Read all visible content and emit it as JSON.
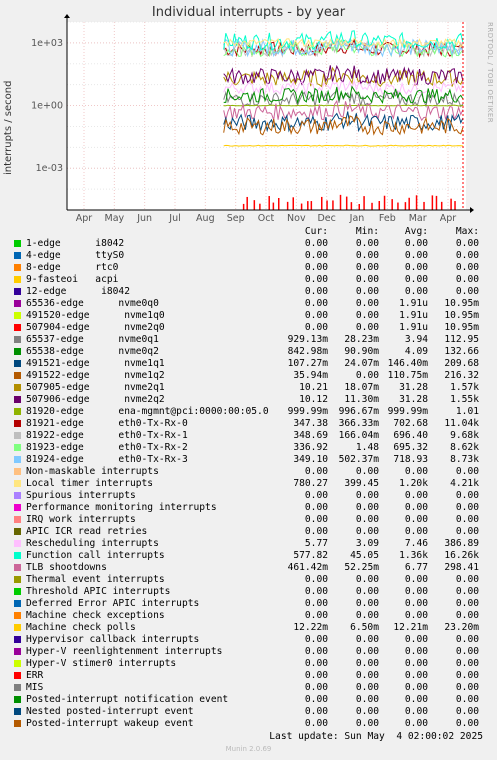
{
  "title": "Individual interrupts - by year",
  "ylabel": "interrupts / second",
  "side_label": "RRDTOOL / TOBI OETIKER",
  "legend_headers": {
    "cur": "Cur:",
    "min": "Min:",
    "avg": "Avg:",
    "max": "Max:"
  },
  "legend": [
    {
      "name": "1-edge      i8042",
      "color": "#00cc00",
      "cur": "0.00",
      "min": "0.00",
      "avg": "0.00",
      "max": "0.00"
    },
    {
      "name": "4-edge      ttyS0",
      "color": "#0066b3",
      "cur": "0.00",
      "min": "0.00",
      "avg": "0.00",
      "max": "0.00"
    },
    {
      "name": "8-edge      rtc0",
      "color": "#ff8000",
      "cur": "0.00",
      "min": "0.00",
      "avg": "0.00",
      "max": "0.00"
    },
    {
      "name": "9-fasteoi   acpi",
      "color": "#ffcc00",
      "cur": "0.00",
      "min": "0.00",
      "avg": "0.00",
      "max": "0.00"
    },
    {
      "name": "12-edge      i8042",
      "color": "#330099",
      "cur": "0.00",
      "min": "0.00",
      "avg": "0.00",
      "max": "0.00"
    },
    {
      "name": "65536-edge      nvme0q0",
      "color": "#990099",
      "cur": "0.00",
      "min": "0.00",
      "avg": "1.91u",
      "max": "10.95m"
    },
    {
      "name": "491520-edge      nvme1q0",
      "color": "#ccff00",
      "cur": "0.00",
      "min": "0.00",
      "avg": "1.91u",
      "max": "10.95m"
    },
    {
      "name": "507904-edge      nvme2q0",
      "color": "#ff0000",
      "cur": "0.00",
      "min": "0.00",
      "avg": "1.91u",
      "max": "10.95m"
    },
    {
      "name": "65537-edge      nvme0q1",
      "color": "#808080",
      "cur": "929.13m",
      "min": "28.23m",
      "avg": "3.94",
      "max": "112.95"
    },
    {
      "name": "65538-edge      nvme0q2",
      "color": "#008f00",
      "cur": "842.98m",
      "min": "90.90m",
      "avg": "4.09",
      "max": "132.66"
    },
    {
      "name": "491521-edge      nvme1q1",
      "color": "#00487d",
      "cur": "107.27m",
      "min": "24.07m",
      "avg": "146.40m",
      "max": "209.68"
    },
    {
      "name": "491522-edge      nvme1q2",
      "color": "#b35a00",
      "cur": "35.94m",
      "min": "0.00",
      "avg": "110.75m",
      "max": "216.32"
    },
    {
      "name": "507905-edge      nvme2q1",
      "color": "#b38f00",
      "cur": "10.21",
      "min": "18.07m",
      "avg": "31.28",
      "max": "1.57k"
    },
    {
      "name": "507906-edge      nvme2q2",
      "color": "#6b006b",
      "cur": "10.12",
      "min": "11.30m",
      "avg": "31.28",
      "max": "1.55k"
    },
    {
      "name": "81920-edge      ena-mgmnt@pci:0000:00:05.0",
      "color": "#8fb300",
      "cur": "999.99m",
      "min": "996.67m",
      "avg": "999.99m",
      "max": "1.01"
    },
    {
      "name": "81921-edge      eth0-Tx-Rx-0",
      "color": "#b30000",
      "cur": "347.38",
      "min": "366.33m",
      "avg": "702.68",
      "max": "11.04k"
    },
    {
      "name": "81922-edge      eth0-Tx-Rx-1",
      "color": "#bebebe",
      "cur": "348.69",
      "min": "166.04m",
      "avg": "696.40",
      "max": "9.68k"
    },
    {
      "name": "81923-edge      eth0-Tx-Rx-2",
      "color": "#80ff80",
      "cur": "336.92",
      "min": "1.48",
      "avg": "695.32",
      "max": "8.62k"
    },
    {
      "name": "81924-edge      eth0-Tx-Rx-3",
      "color": "#80c9ff",
      "cur": "349.10",
      "min": "502.37m",
      "avg": "718.93",
      "max": "8.73k"
    },
    {
      "name": "Non-maskable interrupts",
      "color": "#ffc080",
      "cur": "0.00",
      "min": "0.00",
      "avg": "0.00",
      "max": "0.00"
    },
    {
      "name": "Local timer interrupts",
      "color": "#ffe680",
      "cur": "780.27",
      "min": "399.45",
      "avg": "1.20k",
      "max": "4.21k"
    },
    {
      "name": "Spurious interrupts",
      "color": "#aa80ff",
      "cur": "0.00",
      "min": "0.00",
      "avg": "0.00",
      "max": "0.00"
    },
    {
      "name": "Performance monitoring interrupts",
      "color": "#ee00cc",
      "cur": "0.00",
      "min": "0.00",
      "avg": "0.00",
      "max": "0.00"
    },
    {
      "name": "IRQ work interrupts",
      "color": "#ff8080",
      "cur": "0.00",
      "min": "0.00",
      "avg": "0.00",
      "max": "0.00"
    },
    {
      "name": "APIC ICR read retries",
      "color": "#666600",
      "cur": "0.00",
      "min": "0.00",
      "avg": "0.00",
      "max": "0.00"
    },
    {
      "name": "Rescheduling interrupts",
      "color": "#ffbfff",
      "cur": "5.77",
      "min": "3.09",
      "avg": "7.46",
      "max": "386.89"
    },
    {
      "name": "Function call interrupts",
      "color": "#00ffcc",
      "cur": "577.82",
      "min": "45.05",
      "avg": "1.36k",
      "max": "16.26k"
    },
    {
      "name": "TLB shootdowns",
      "color": "#cc6699",
      "cur": "461.42m",
      "min": "52.25m",
      "avg": "6.77",
      "max": "298.41"
    },
    {
      "name": "Thermal event interrupts",
      "color": "#999900",
      "cur": "0.00",
      "min": "0.00",
      "avg": "0.00",
      "max": "0.00"
    },
    {
      "name": "Threshold APIC interrupts",
      "color": "#00cc00",
      "cur": "0.00",
      "min": "0.00",
      "avg": "0.00",
      "max": "0.00"
    },
    {
      "name": "Deferred Error APIC interrupts",
      "color": "#0066b3",
      "cur": "0.00",
      "min": "0.00",
      "avg": "0.00",
      "max": "0.00"
    },
    {
      "name": "Machine check exceptions",
      "color": "#ff8000",
      "cur": "0.00",
      "min": "0.00",
      "avg": "0.00",
      "max": "0.00"
    },
    {
      "name": "Machine check polls",
      "color": "#ffcc00",
      "cur": "12.22m",
      "min": "6.50m",
      "avg": "12.21m",
      "max": "23.20m"
    },
    {
      "name": "Hypervisor callback interrupts",
      "color": "#330099",
      "cur": "0.00",
      "min": "0.00",
      "avg": "0.00",
      "max": "0.00"
    },
    {
      "name": "Hyper-V reenlightenment interrupts",
      "color": "#990099",
      "cur": "0.00",
      "min": "0.00",
      "avg": "0.00",
      "max": "0.00"
    },
    {
      "name": "Hyper-V stimer0 interrupts",
      "color": "#ccff00",
      "cur": "0.00",
      "min": "0.00",
      "avg": "0.00",
      "max": "0.00"
    },
    {
      "name": "ERR",
      "color": "#ff0000",
      "cur": "0.00",
      "min": "0.00",
      "avg": "0.00",
      "max": "0.00"
    },
    {
      "name": "MIS",
      "color": "#808080",
      "cur": "0.00",
      "min": "0.00",
      "avg": "0.00",
      "max": "0.00"
    },
    {
      "name": "Posted-interrupt notification event",
      "color": "#008f00",
      "cur": "0.00",
      "min": "0.00",
      "avg": "0.00",
      "max": "0.00"
    },
    {
      "name": "Nested posted-interrupt event",
      "color": "#00487d",
      "cur": "0.00",
      "min": "0.00",
      "avg": "0.00",
      "max": "0.00"
    },
    {
      "name": "Posted-interrupt wakeup event",
      "color": "#b35a00",
      "cur": "0.00",
      "min": "0.00",
      "avg": "0.00",
      "max": "0.00"
    }
  ],
  "footer": "Last update: Sun May  4 02:00:02 2025",
  "version": "Munin 2.0.69",
  "chart_data": {
    "type": "line",
    "title": "Individual interrupts - by year",
    "ylabel": "interrupts / second",
    "yscale": "log",
    "ylim": [
      1e-05,
      10000.0
    ],
    "yticks": [
      {
        "value": 1000,
        "label": "1e+03"
      },
      {
        "value": 1,
        "label": "1e+00"
      },
      {
        "value": 0.001,
        "label": "1e-03"
      }
    ],
    "xticks": [
      "Apr",
      "May",
      "Jun",
      "Jul",
      "Aug",
      "Sep",
      "Oct",
      "Nov",
      "Dec",
      "Jan",
      "Feb",
      "Mar",
      "Apr"
    ],
    "data_start_month": "Sep",
    "grid": true,
    "series": [
      {
        "name": "81921-edge      eth0-Tx-Rx-0",
        "color": "#b30000",
        "level": 500,
        "amp": 0.35
      },
      {
        "name": "81922-edge      eth0-Tx-Rx-1",
        "color": "#bebebe",
        "level": 520,
        "amp": 0.35
      },
      {
        "name": "81923-edge      eth0-Tx-Rx-2",
        "color": "#80ff80",
        "level": 480,
        "amp": 0.35
      },
      {
        "name": "81924-edge      eth0-Tx-Rx-3",
        "color": "#80c9ff",
        "level": 600,
        "amp": 0.4
      },
      {
        "name": "Function call interrupts",
        "color": "#00ffcc",
        "level": 1200,
        "amp": 0.4
      },
      {
        "name": "Local timer interrupts",
        "color": "#ffe680",
        "level": 1000,
        "amp": 0.2
      },
      {
        "name": "507905-edge      nvme2q1",
        "color": "#b38f00",
        "level": 20,
        "amp": 0.4
      },
      {
        "name": "507906-edge      nvme2q2",
        "color": "#6b006b",
        "level": 25,
        "amp": 0.4
      },
      {
        "name": "Rescheduling interrupts",
        "color": "#ffbfff",
        "level": 7,
        "amp": 0.3
      },
      {
        "name": "65537-edge      nvme0q1",
        "color": "#808080",
        "level": 2,
        "amp": 0.35
      },
      {
        "name": "65538-edge      nvme0q2",
        "color": "#008f00",
        "level": 3,
        "amp": 0.35
      },
      {
        "name": "81920-edge      ena-mgmnt@pci:0000:00:05.0",
        "color": "#8fb300",
        "level": 1,
        "amp": 0.02
      },
      {
        "name": "TLB shootdowns",
        "color": "#cc6699",
        "level": 0.5,
        "amp": 0.4
      },
      {
        "name": "491521-edge      nvme1q1",
        "color": "#00487d",
        "level": 0.15,
        "amp": 0.4
      },
      {
        "name": "491522-edge      nvme1q2",
        "color": "#b35a00",
        "level": 0.1,
        "amp": 0.4
      },
      {
        "name": "Machine check polls",
        "color": "#ffcc00",
        "level": 0.012,
        "amp": 0.02
      }
    ]
  }
}
